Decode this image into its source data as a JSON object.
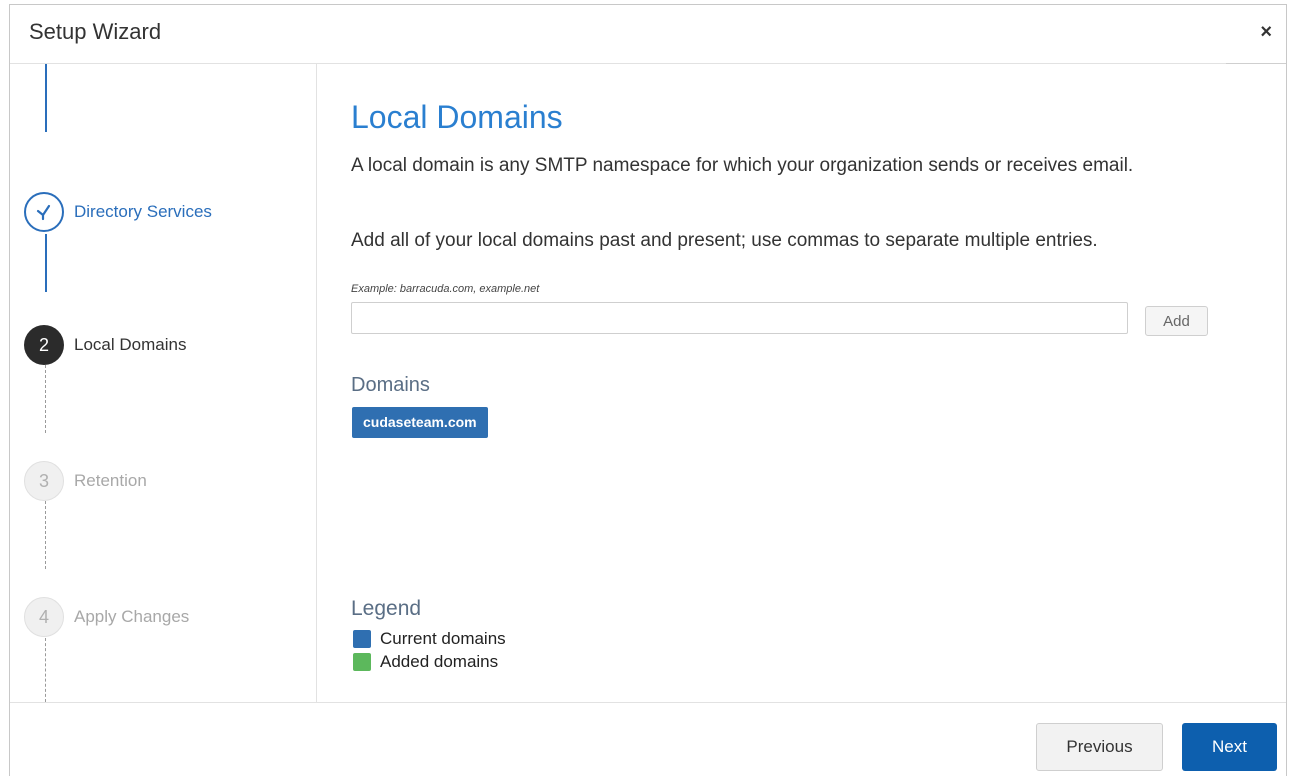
{
  "dialog": {
    "title": "Setup Wizard",
    "close_label": "×"
  },
  "steps": [
    {
      "number": "✓",
      "label": "Directory Services",
      "state": "done"
    },
    {
      "number": "2",
      "label": "Local Domains",
      "state": "current"
    },
    {
      "number": "3",
      "label": "Retention",
      "state": "pending"
    },
    {
      "number": "4",
      "label": "Apply Changes",
      "state": "pending"
    }
  ],
  "main": {
    "title": "Local Domains",
    "description": "A local domain is any SMTP namespace for which your organization sends or receives email.",
    "instructions": "Add all of your local domains past and present; use commas to separate multiple entries.",
    "example": "Example: barracuda.com, example.net",
    "input_value": "",
    "add_label": "Add",
    "domains_heading": "Domains",
    "domains": [
      "cudaseteam.com"
    ]
  },
  "legend": {
    "heading": "Legend",
    "items": [
      {
        "label": "Current domains",
        "color": "#2f6fb1"
      },
      {
        "label": "Added domains",
        "color": "#5cb85c"
      }
    ]
  },
  "footer": {
    "previous_label": "Previous",
    "next_label": "Next"
  },
  "colors": {
    "accent": "#2a7fd0",
    "primary_button": "#0d5fae"
  }
}
